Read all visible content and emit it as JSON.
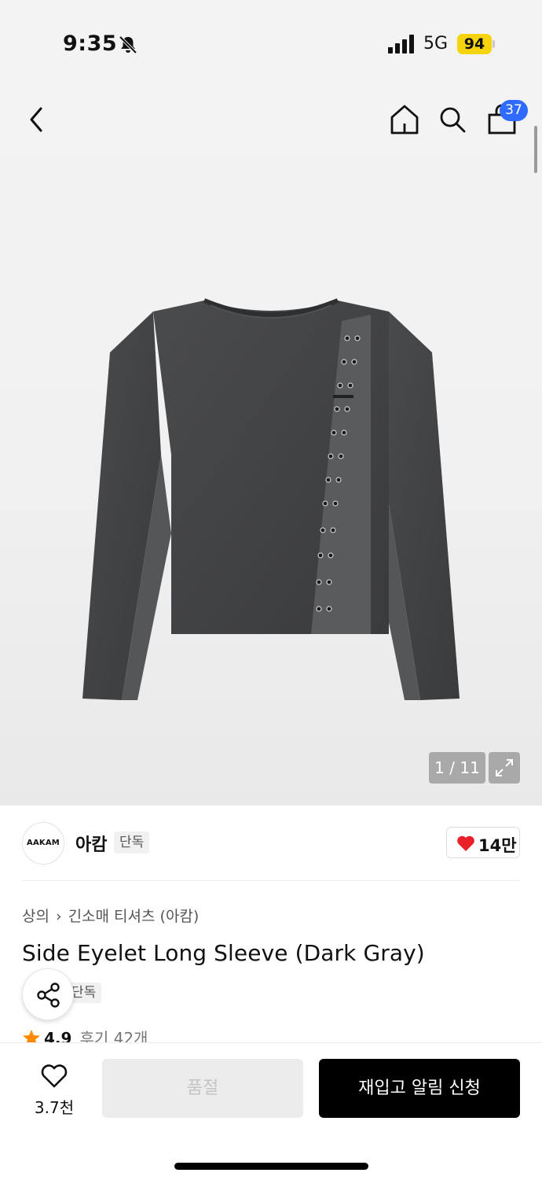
{
  "status_bar": {
    "time": "9:35",
    "network": "5G",
    "battery": "94",
    "icons": [
      "bell-slash-icon",
      "signal-icon"
    ]
  },
  "header": {
    "icons": [
      "back-arrow-icon",
      "home-icon",
      "search-icon",
      "shopping-bag-icon"
    ],
    "cart_count": "37"
  },
  "gallery": {
    "pager": "1 / 11",
    "expand_icon": "expand-icon",
    "image": "dark-gray-long-sleeve-shirt"
  },
  "brand": {
    "logo": "AAKAM",
    "name": "아캄",
    "tag": "단독",
    "likes": "14만"
  },
  "product": {
    "breadcrumb": [
      "상의",
      "긴소매 티셔츠 (아캄)"
    ],
    "title": "Side Eyelet Long Sleeve (Dark Gray)",
    "tag": "단독",
    "rating": "4.9",
    "reviews": "후기 42개"
  },
  "bottom_bar": {
    "wish_count": "3.7천",
    "soldout_label": "품절",
    "restock_label": "재입고 알림 신청"
  },
  "colors": {
    "badge_blue": "#2f6bff",
    "battery_yellow": "#f5d40f",
    "heart_red": "#e8202a",
    "star_orange": "#ff8a00"
  }
}
